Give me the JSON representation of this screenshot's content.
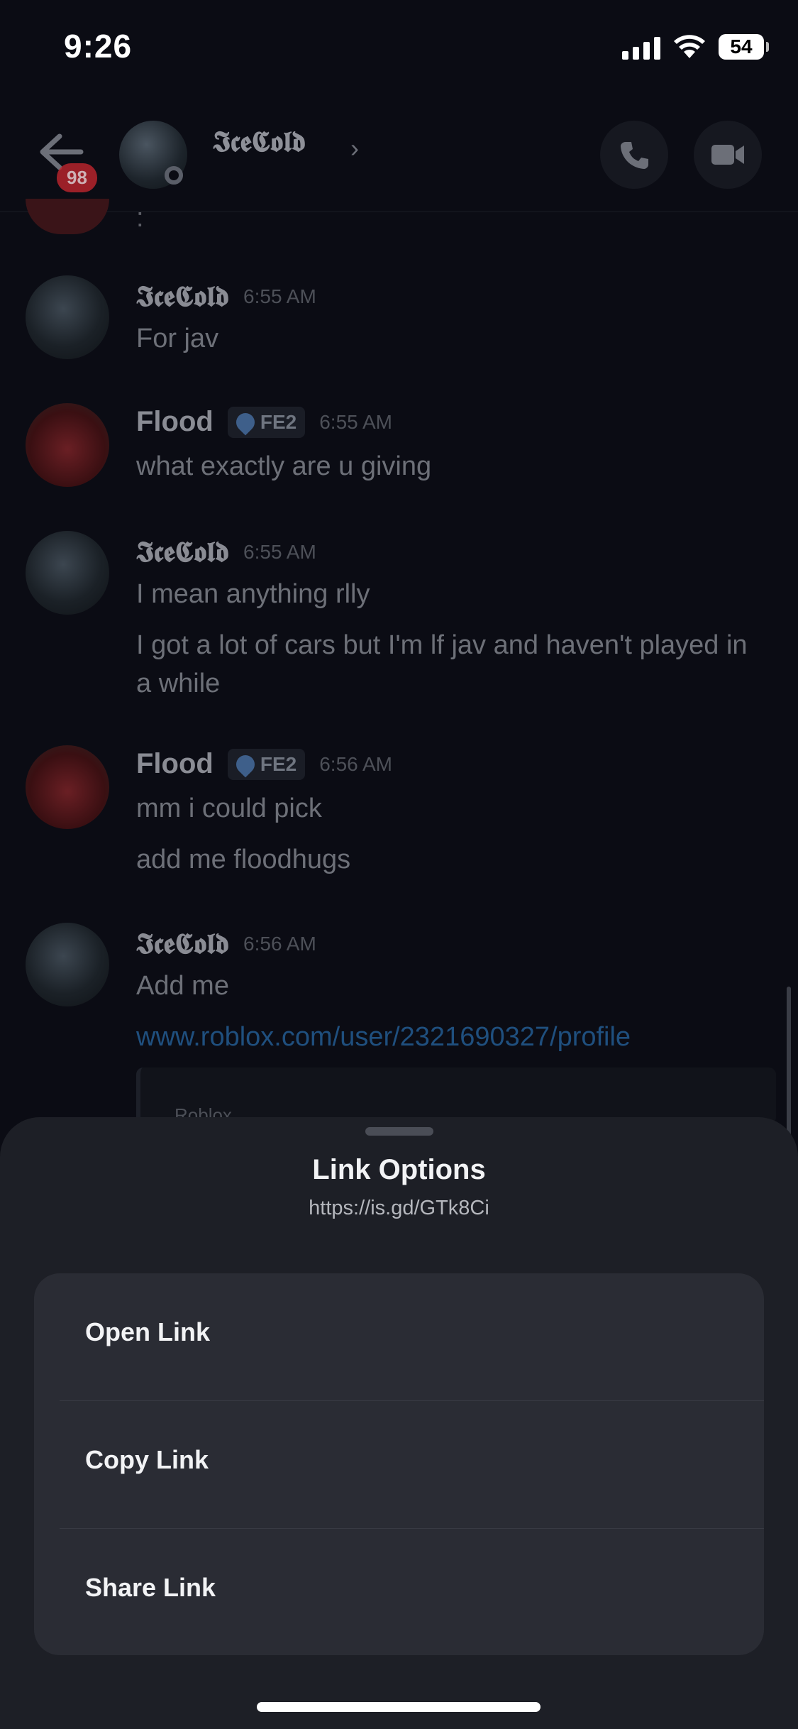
{
  "status_bar": {
    "time": "9:26",
    "battery": "54"
  },
  "header": {
    "unread_badge": "98",
    "name": "𝕴𝖈𝖊𝕮𝖔𝖑𝖉",
    "chevron": "›"
  },
  "chat": {
    "partial_text": ":",
    "messages": [
      {
        "author": "𝕴𝖈𝖊𝕮𝖔𝖑𝖉",
        "time": "6:55 AM",
        "lines": [
          "For jav"
        ]
      },
      {
        "author": "Flood",
        "tag": "FE2",
        "time": "6:55 AM",
        "lines": [
          "what exactly are u giving"
        ]
      },
      {
        "author": "𝕴𝖈𝖊𝕮𝖔𝖑𝖉",
        "time": "6:55 AM",
        "lines": [
          "I mean anything rlly",
          "I got a lot of cars but I'm lf jav and haven't played in a while"
        ]
      },
      {
        "author": "Flood",
        "tag": "FE2",
        "time": "6:56 AM",
        "lines": [
          "mm i could pick",
          "add me floodhugs"
        ]
      },
      {
        "author": "𝕴𝖈𝖊𝕮𝖔𝖑𝖉",
        "time": "6:56 AM",
        "lines": [
          "Add me",
          "www.roblox.com/user/2321690327/profile"
        ]
      }
    ],
    "embed_provider": "Roblox"
  },
  "sheet": {
    "title": "Link Options",
    "url": "https://is.gd/GTk8Ci",
    "options": [
      "Open Link",
      "Copy Link",
      "Share Link"
    ]
  }
}
